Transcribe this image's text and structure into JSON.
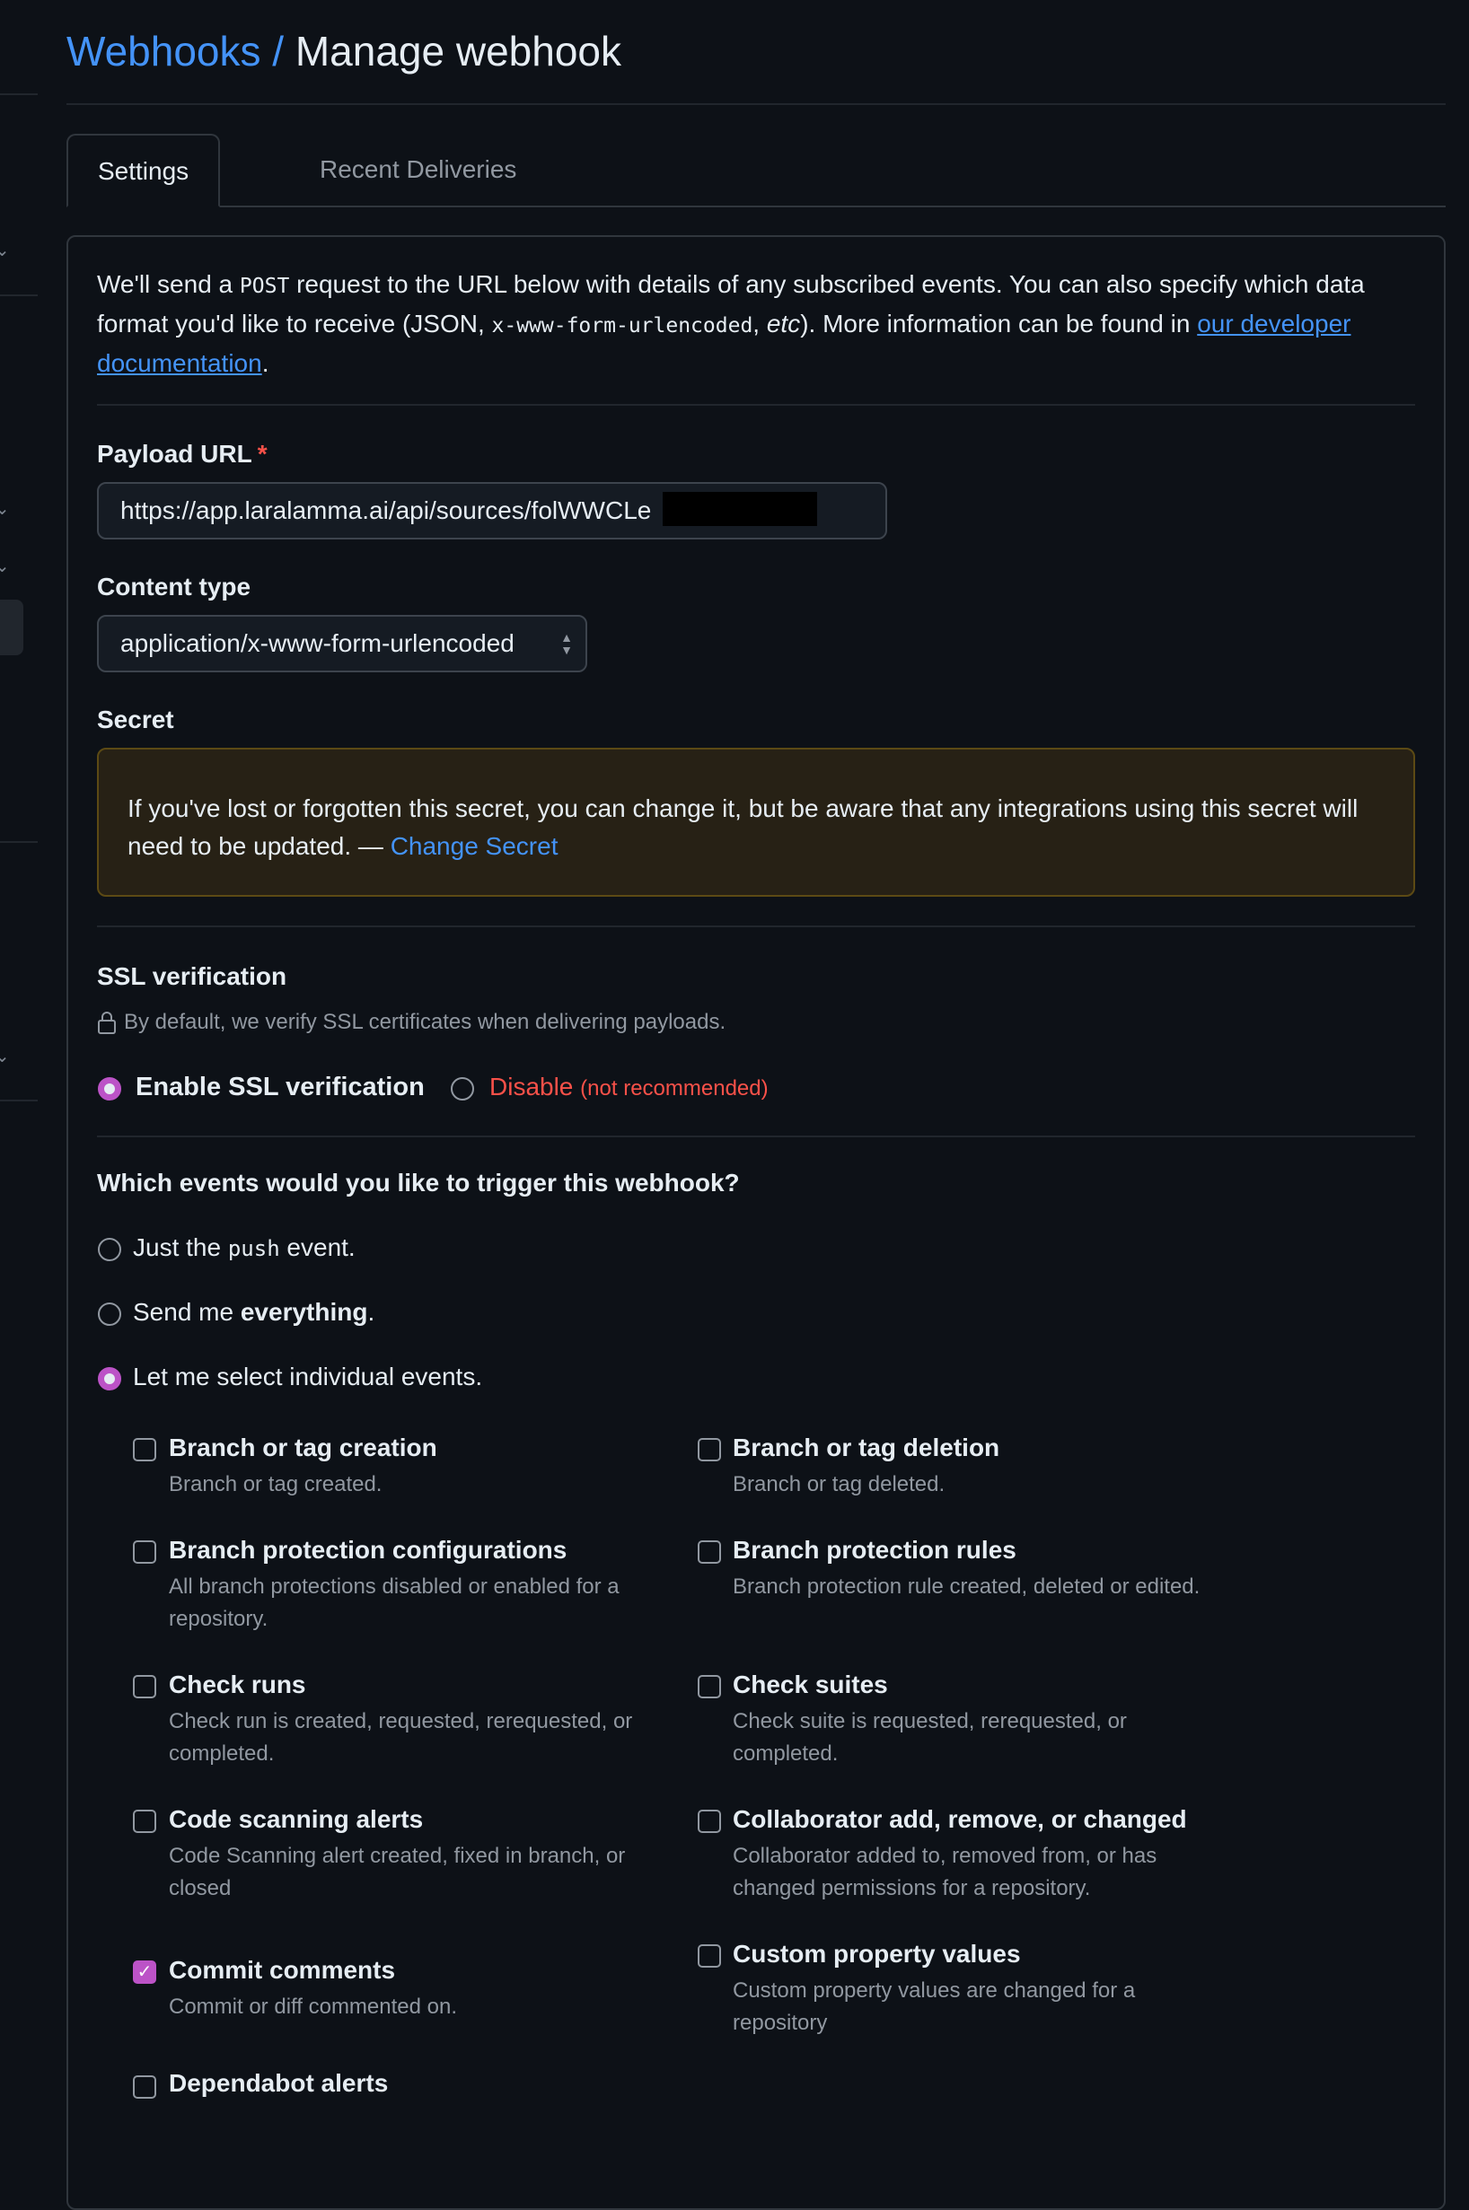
{
  "breadcrumb": {
    "parent": "Webhooks /",
    "current": "Manage webhook"
  },
  "tabs": [
    {
      "label": "Settings",
      "active": true
    },
    {
      "label": "Recent Deliveries",
      "active": false
    }
  ],
  "intro": {
    "part1": "We'll send a ",
    "code1": "POST",
    "part2": " request to the URL below with details of any subscribed events. You can also specify which data format you'd like to receive (JSON, ",
    "code2": "x-www-form-urlencoded",
    "part3": ", ",
    "etc": "etc",
    "part4": "). More information can be found in ",
    "link": "our developer documentation",
    "part5": "."
  },
  "payload_url": {
    "label": "Payload URL",
    "required_mark": "*",
    "value": "https://app.laralamma.ai/api/sources/folWWCLe"
  },
  "content_type": {
    "label": "Content type",
    "value": "application/x-www-form-urlencoded"
  },
  "secret": {
    "label": "Secret",
    "warning": "If you've lost or forgotten this secret, you can change it, but be aware that any integrations using this secret will need to be updated. — ",
    "link": "Change Secret"
  },
  "ssl": {
    "label": "SSL verification",
    "note": "By default, we verify SSL certificates when delivering payloads.",
    "enable": "Enable SSL verification",
    "disable": "Disable",
    "disable_note": "(not recommended)",
    "selected": "enable"
  },
  "events": {
    "question": "Which events would you like to trigger this webhook?",
    "options": [
      {
        "pre": "Just the ",
        "code": "push",
        "post": " event."
      },
      {
        "pre": "Send me ",
        "bold": "everything",
        "post": "."
      },
      {
        "text": "Let me select individual events."
      }
    ],
    "selected_option": 2,
    "items": [
      {
        "title": "Branch or tag creation",
        "desc": "Branch or tag created.",
        "checked": false
      },
      {
        "title": "Branch or tag deletion",
        "desc": "Branch or tag deleted.",
        "checked": false
      },
      {
        "title": "Branch protection configurations",
        "desc": "All branch protections disabled or enabled for a repository.",
        "checked": false
      },
      {
        "title": "Branch protection rules",
        "desc": "Branch protection rule created, deleted or edited.",
        "checked": false
      },
      {
        "title": "Check runs",
        "desc": "Check run is created, requested, rerequested, or completed.",
        "checked": false
      },
      {
        "title": "Check suites",
        "desc": "Check suite is requested, rerequested, or completed.",
        "checked": false
      },
      {
        "title": "Code scanning alerts",
        "desc": "Code Scanning alert created, fixed in branch, or closed",
        "checked": false
      },
      {
        "title": "Collaborator add, remove, or changed",
        "desc": "Collaborator added to, removed from, or has changed permissions for a repository.",
        "checked": false
      },
      {
        "title": "Commit comments",
        "desc": "Commit or diff commented on.",
        "checked": true
      },
      {
        "title": "Custom property values",
        "desc": "Custom property values are changed for a repository",
        "checked": false
      },
      {
        "title": "Dependabot alerts",
        "desc": "",
        "checked": false
      }
    ]
  },
  "colors": {
    "accent": "#bc53c7",
    "link": "#4493f8",
    "danger": "#f85149",
    "background": "#0d1117"
  }
}
